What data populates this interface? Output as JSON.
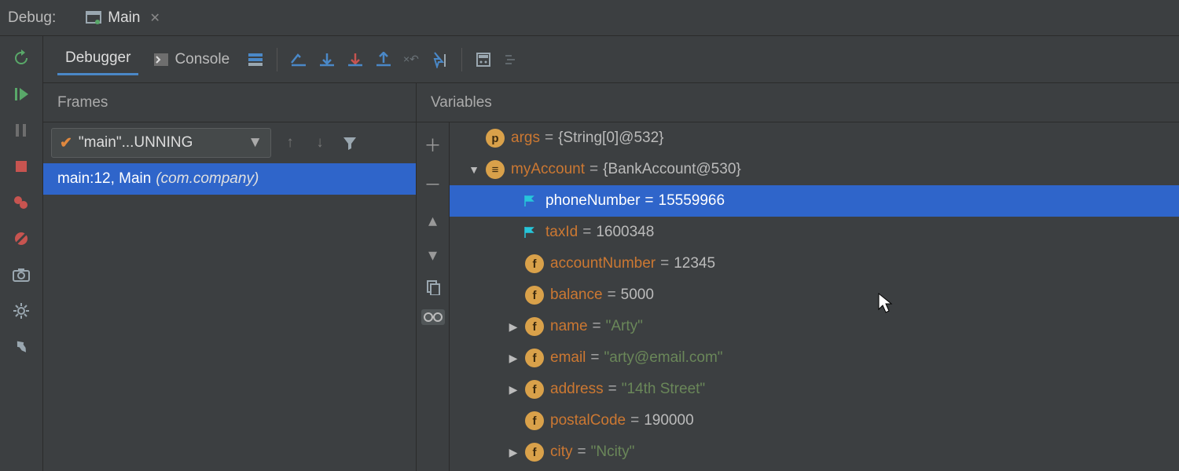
{
  "titlebar": {
    "label": "Debug:",
    "tab_name": "Main"
  },
  "toolbar": {
    "debugger_tab": "Debugger",
    "console_tab": "Console"
  },
  "frames": {
    "title": "Frames",
    "thread": "\"main\"...UNNING",
    "stack": {
      "loc": "main:12, Main",
      "pkg": "(com.company)"
    }
  },
  "variables": {
    "title": "Variables",
    "items": [
      {
        "name": "args",
        "eq": "=",
        "val": "{String[0]@532}",
        "badge": "p",
        "arrow": "",
        "lvl": 1
      },
      {
        "name": "myAccount",
        "eq": "=",
        "val": "{BankAccount@530}",
        "badge": "≡",
        "arrow": "▼",
        "lvl": 1
      },
      {
        "name": "phoneNumber",
        "eq": "=",
        "val": "15559966",
        "flag": true,
        "lvl": 2,
        "sel": true
      },
      {
        "name": "taxId",
        "eq": "=",
        "val": "1600348",
        "flag": true,
        "lvl": 2
      },
      {
        "name": "accountNumber",
        "eq": "=",
        "val": "12345",
        "badge": "f",
        "lvl": 2
      },
      {
        "name": "balance",
        "eq": "=",
        "val": "5000",
        "badge": "f",
        "lvl": 2
      },
      {
        "name": "name",
        "eq": "=",
        "val": "\"Arty\"",
        "badge": "f",
        "arrow": "▶",
        "lvl": 2,
        "str": true
      },
      {
        "name": "email",
        "eq": "=",
        "val": "\"arty@email.com\"",
        "badge": "f",
        "arrow": "▶",
        "lvl": 2,
        "str": true
      },
      {
        "name": "address",
        "eq": "=",
        "val": "\"14th Street\"",
        "badge": "f",
        "arrow": "▶",
        "lvl": 2,
        "str": true
      },
      {
        "name": "postalCode",
        "eq": "=",
        "val": "190000",
        "badge": "f",
        "lvl": 2
      },
      {
        "name": "city",
        "eq": "=",
        "val": "\"Ncity\"",
        "badge": "f",
        "arrow": "▶",
        "lvl": 2,
        "str": true
      }
    ]
  }
}
